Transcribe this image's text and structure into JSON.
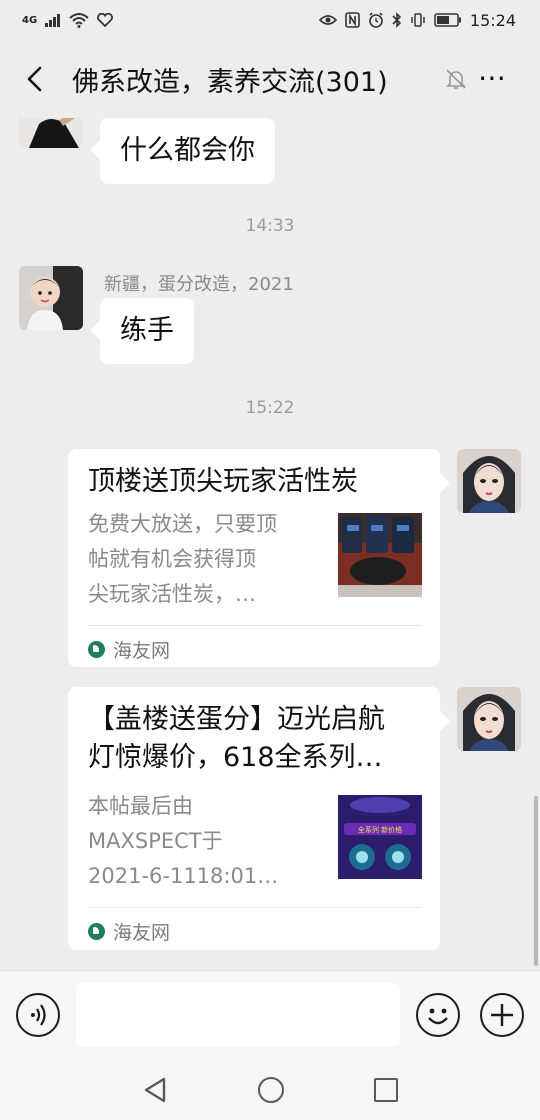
{
  "status_bar": {
    "network": "4G",
    "time": "15:24",
    "icons": [
      "signal-icon",
      "wifi-icon",
      "heart-icon",
      "eye-icon",
      "nfc-icon",
      "alarm-icon",
      "bluetooth-icon",
      "vibrate-icon",
      "battery-icon"
    ]
  },
  "header": {
    "back_icon": "chevron-left-icon",
    "title": "佛系改造，素养交流(301)",
    "mute_icon": "bell-muted-icon",
    "more_icon": "more-dots-icon"
  },
  "messages": [
    {
      "type": "text",
      "direction": "incoming",
      "text": "什么都会你"
    },
    {
      "type": "time",
      "text": "14:33"
    },
    {
      "type": "text",
      "direction": "incoming",
      "sender": "新疆，蛋分改造，2021",
      "text": "练手"
    },
    {
      "type": "time",
      "text": "15:22"
    },
    {
      "type": "link_card",
      "direction": "outgoing",
      "title": "顶楼送顶尖玩家活性炭",
      "desc": [
        "免费大放送，只要顶",
        "帖就有机会获得顶",
        "尖玩家活性炭，…"
      ],
      "source": "海友网"
    },
    {
      "type": "link_card",
      "direction": "outgoing",
      "title": [
        "【盖楼送蛋分】迈光启航",
        "灯惊爆价，618全系列…"
      ],
      "desc": [
        "本帖最后由",
        "MAXSPECT于",
        "2021-6-1118:01…"
      ],
      "source": "海友网",
      "thumb_caption": "全系列 新价格"
    }
  ],
  "input_bar": {
    "voice_icon": "voice-icon",
    "text_value": "",
    "emoji_icon": "emoji-icon",
    "plus_icon": "plus-icon"
  },
  "nav_bar": {
    "icons": [
      "nav-back-icon",
      "nav-home-icon",
      "nav-recents-icon"
    ]
  },
  "colors": {
    "chat_bg": "#ededed",
    "bubble_bg": "#ffffff",
    "timestamp": "#9b9b9b",
    "source_icon": "#1e7d62"
  }
}
